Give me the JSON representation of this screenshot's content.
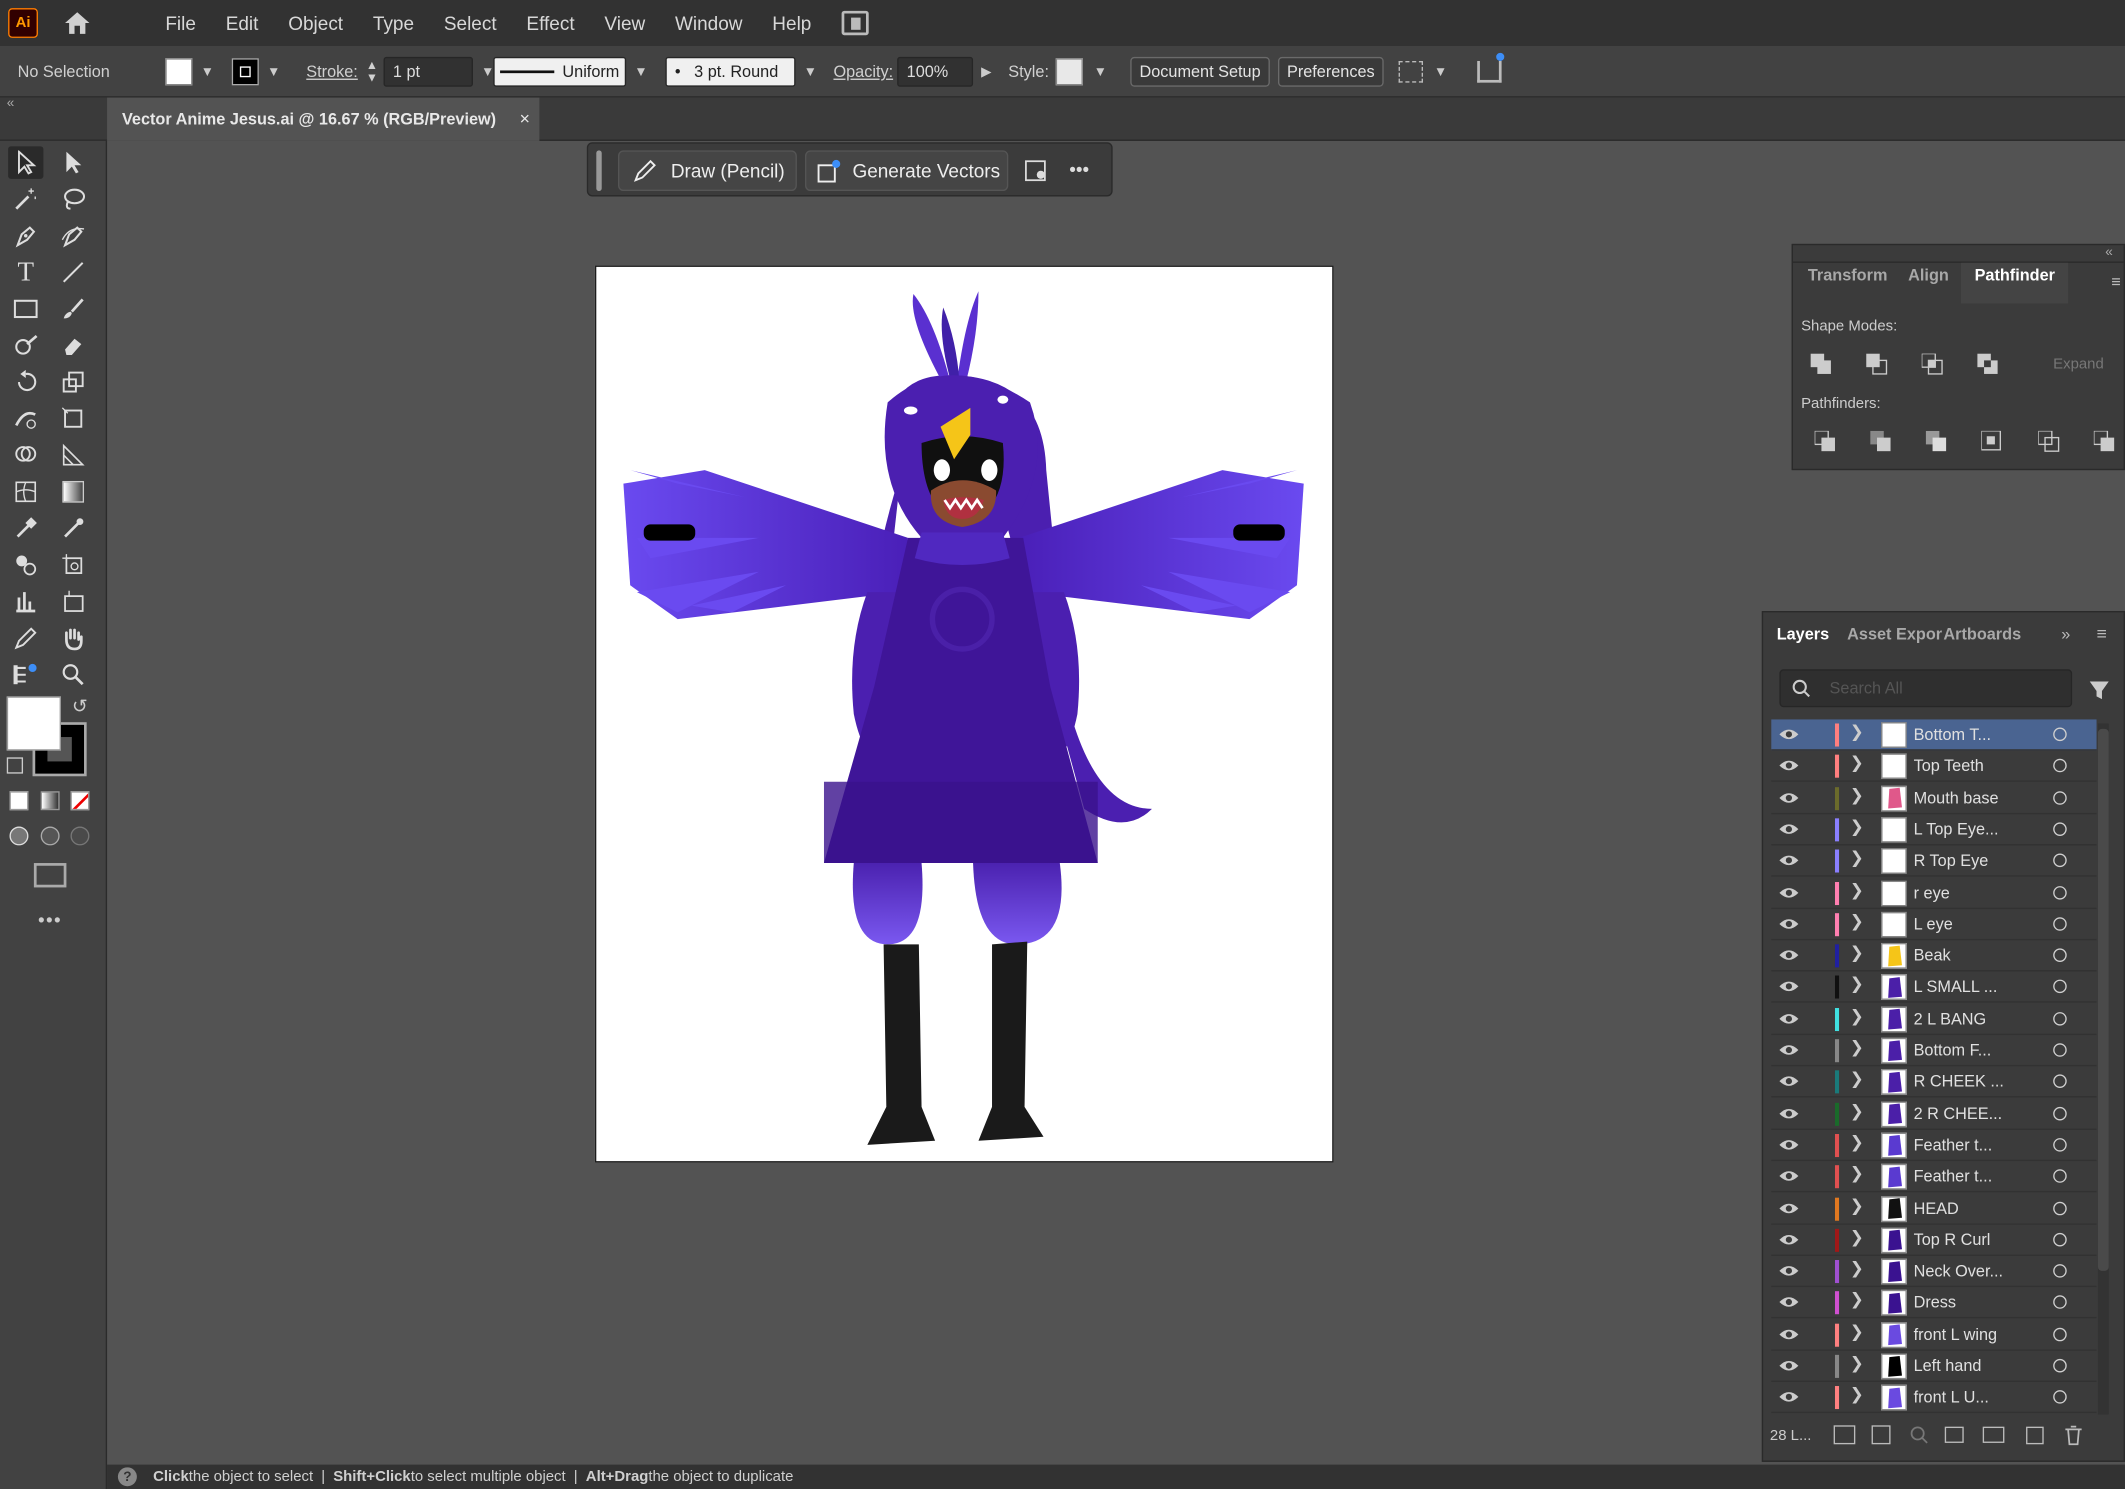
{
  "app": {
    "logo": "Ai",
    "home_icon": "home-icon"
  },
  "menu": [
    "File",
    "Edit",
    "Object",
    "Type",
    "Select",
    "Effect",
    "View",
    "Window",
    "Help"
  ],
  "control": {
    "selection": "No Selection",
    "stroke_label": "Stroke:",
    "stroke_weight": "1 pt",
    "profile": "Uniform",
    "brush": "3 pt. Round",
    "opacity_label": "Opacity:",
    "opacity": "100%",
    "style_label": "Style:",
    "document_setup": "Document Setup",
    "preferences": "Preferences"
  },
  "document": {
    "tab_title": "Vector Anime Jesus.ai @ 16.67 % (RGB/Preview)",
    "close": "×"
  },
  "context_bar": {
    "draw": "Draw (Pencil)",
    "generate": "Generate Vectors",
    "more": "•••"
  },
  "toolbar": {
    "more": "•••"
  },
  "pathfinder": {
    "tabs": [
      "Transform",
      "Align",
      "Pathfinder"
    ],
    "active_tab": "Pathfinder",
    "shape_modes": "Shape Modes:",
    "expand": "Expand",
    "pathfinders": "Pathfinders:"
  },
  "layers": {
    "tabs": [
      "Layers",
      "Asset Expor",
      "Artboards"
    ],
    "search_placeholder": "Search All",
    "count": "28 L...",
    "items": [
      {
        "name": "Bottom T...",
        "color": "#ff7f7f",
        "thumb": "#ffffff",
        "selected": true
      },
      {
        "name": "Top Teeth",
        "color": "#ff7f7f",
        "thumb": "#ffffff"
      },
      {
        "name": "Mouth base",
        "color": "#6b6b2b",
        "thumb": "#e0588a"
      },
      {
        "name": "L Top Eye...",
        "color": "#8a7fff",
        "thumb": "#ffffff"
      },
      {
        "name": "R Top Eye",
        "color": "#8a7fff",
        "thumb": "#ffffff"
      },
      {
        "name": "r eye",
        "color": "#ff7fb0",
        "thumb": "#ffffff"
      },
      {
        "name": "L eye",
        "color": "#ff7fb0",
        "thumb": "#ffffff"
      },
      {
        "name": "Beak",
        "color": "#2020a0",
        "thumb": "#f5c518"
      },
      {
        "name": "L SMALL ...",
        "color": "#101010",
        "thumb": "#4b1fa8"
      },
      {
        "name": "2 L BANG",
        "color": "#40e0e0",
        "thumb": "#4b1fa8"
      },
      {
        "name": "Bottom F...",
        "color": "#888888",
        "thumb": "#4b1fa8"
      },
      {
        "name": "R CHEEK ...",
        "color": "#1a7a7a",
        "thumb": "#4b1fa8"
      },
      {
        "name": "2 R CHEE...",
        "color": "#1a6a2a",
        "thumb": "#4b1fa8"
      },
      {
        "name": "Feather t...",
        "color": "#e05050",
        "thumb": "#5a3ad0"
      },
      {
        "name": "Feather t...",
        "color": "#e05050",
        "thumb": "#5a3ad0"
      },
      {
        "name": "HEAD",
        "color": "#e07820",
        "thumb": "#111111"
      },
      {
        "name": "Top R Curl",
        "color": "#a01818",
        "thumb": "#3a1290"
      },
      {
        "name": "Neck Over...",
        "color": "#a050d0",
        "thumb": "#3a1290"
      },
      {
        "name": "Dress",
        "color": "#d050d0",
        "thumb": "#3a1290"
      },
      {
        "name": "front L wing",
        "color": "#ff8080",
        "thumb": "#6a4ae0"
      },
      {
        "name": "Left hand",
        "color": "#888888",
        "thumb": "#000000"
      },
      {
        "name": "front L U...",
        "color": "#ff8080",
        "thumb": "#6a4ae0"
      }
    ]
  },
  "status": {
    "b1": "Click",
    "t1": " the object to select",
    "sep": "|",
    "b2": "Shift+Click",
    "t2": " to select multiple object",
    "b3": "Alt+Drag",
    "t3": " the object to duplicate"
  }
}
